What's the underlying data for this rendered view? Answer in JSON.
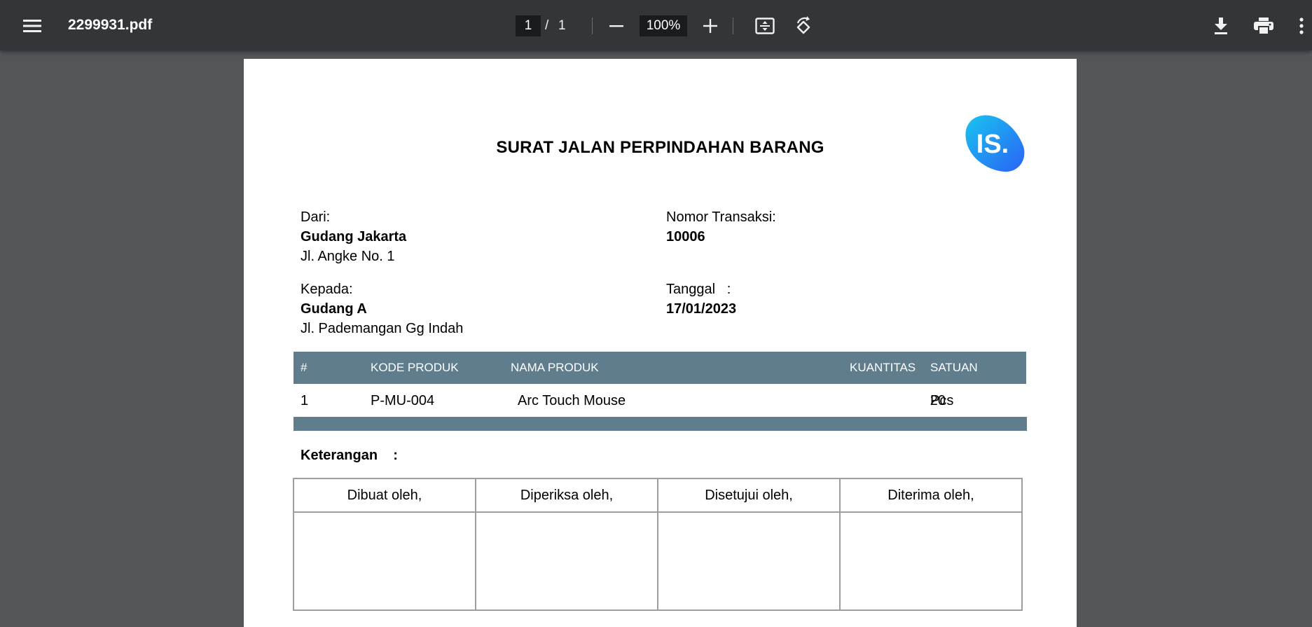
{
  "viewer": {
    "file_name": "2299931.pdf",
    "current_page": "1",
    "page_separator": "/",
    "total_pages": "1",
    "zoom": "100%",
    "icons": [
      "menu-icon",
      "zoom-out-icon",
      "zoom-in-icon",
      "fit-page-icon",
      "rotate-icon",
      "download-icon",
      "print-icon",
      "more-icon"
    ]
  },
  "document": {
    "title": "SURAT JALAN PERPINDAHAN BARANG",
    "logo_text": "IS.",
    "brand_colors": {
      "logo_start": "#19c4f0",
      "logo_end": "#2a63f5",
      "table_header": "#5f7d8c"
    },
    "from": {
      "label": "Dari:",
      "name": "Gudang Jakarta",
      "address": "Jl. Angke No. 1"
    },
    "to": {
      "label": "Kepada:",
      "name": "Gudang A",
      "address": "Jl. Pademangan Gg Indah"
    },
    "transaction": {
      "label": "Nomor Transaksi:",
      "value": "10006"
    },
    "date": {
      "label": "Tanggal   :",
      "value": "17/01/2023"
    },
    "items_table": {
      "headers": {
        "no": "#",
        "code": "KODE PRODUK",
        "name": "NAMA PRODUK",
        "qty": "KUANTITAS",
        "unit": "SATUAN"
      },
      "rows": [
        {
          "no": "1",
          "code": "P-MU-004",
          "name": "Arc Touch Mouse",
          "qty": "20",
          "unit": "Pcs"
        }
      ]
    },
    "notes_label": "Keterangan    :",
    "signatures": [
      "Dibuat oleh,",
      "Diperiksa oleh,",
      "Disetujui oleh,",
      "Diterima oleh,"
    ]
  }
}
